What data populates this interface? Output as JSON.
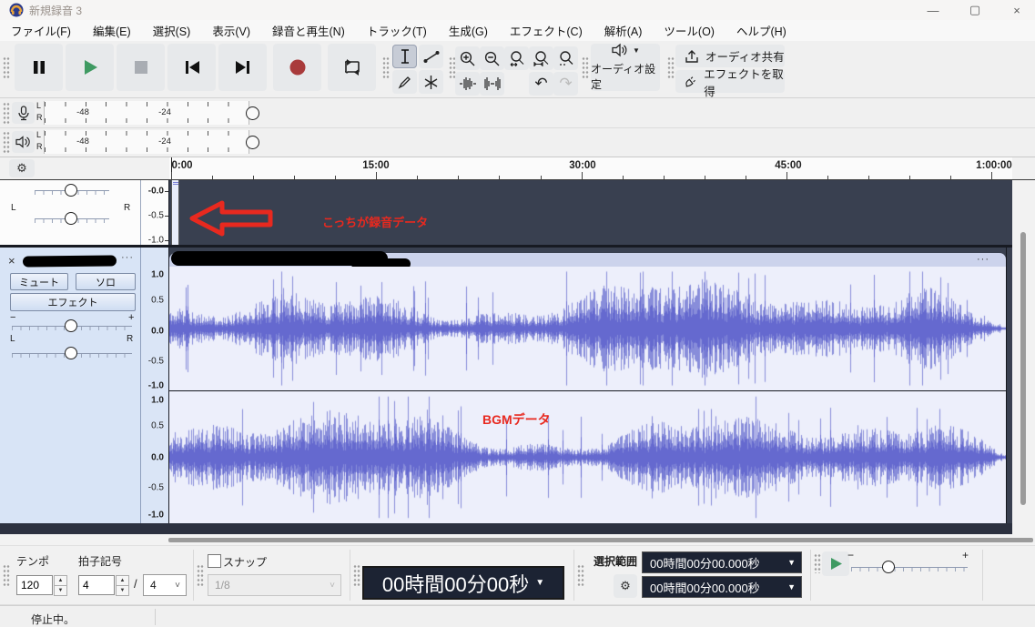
{
  "window": {
    "title": "新規録音 3",
    "minimize": "—",
    "maximize": "▢",
    "close": "×"
  },
  "menu": {
    "items": [
      "ファイル(F)",
      "編集(E)",
      "選択(S)",
      "表示(V)",
      "録音と再生(N)",
      "トラック(T)",
      "生成(G)",
      "エフェクト(C)",
      "解析(A)",
      "ツール(O)",
      "ヘルプ(H)"
    ]
  },
  "toolbar": {
    "audio_setup_label": "オーディオ設定",
    "share_audio_label": "オーディオ共有",
    "get_effects_label": "エフェクトを取得"
  },
  "meters": {
    "record": {
      "left": "L",
      "right": "R",
      "ticks": [
        "-48",
        "-24"
      ]
    },
    "playback": {
      "left": "L",
      "right": "R",
      "ticks": [
        "-48",
        "-24"
      ]
    }
  },
  "timeline": {
    "labels": [
      "0:00",
      "15:00",
      "30:00",
      "45:00",
      "1:00:00"
    ]
  },
  "track1": {
    "ruler": [
      "-0.0",
      "-0.5",
      "-1.0"
    ],
    "annotation": "こっちが録音データ"
  },
  "track2": {
    "close": "×",
    "menu_dots": "···",
    "mute_label": "ミュート",
    "solo_label": "ソロ",
    "effects_label": "エフェクト",
    "gain_minus": "−",
    "gain_plus": "+",
    "pan_left": "L",
    "pan_right": "R",
    "clip_menu_dots": "···",
    "ruler_ch1": [
      "1.0",
      "0.5",
      "0.0",
      "-0.5",
      "-1.0"
    ],
    "ruler_ch2": [
      "1.0",
      "0.5",
      "0.0",
      "-0.5",
      "-1.0"
    ],
    "annotation": "BGMデータ"
  },
  "waveform": {
    "bg": "#edeffb",
    "peak_color": "#888dda",
    "rms_color": "#6569cf",
    "seeds": [
      11,
      29
    ]
  },
  "colors": {
    "play_green": "#3f9a62",
    "record_red": "#a93b3b",
    "annotation_red": "#e8291f",
    "track_background_dark": "#394050",
    "selected_panel_blue": "#d8e4f6"
  },
  "bottom": {
    "tempo_label": "テンポ",
    "tempo_value": "120",
    "timesig_label": "拍子記号",
    "timesig_upper": "4",
    "timesig_divider": "/",
    "timesig_lower": "4",
    "snap_label": "スナップ",
    "snap_value": "1/8",
    "time_display": "00時間00分00秒",
    "selection_label": "選択範囲",
    "selection_start": "00時間00分00.000秒",
    "selection_end": "00時間00分00.000秒",
    "slider_minus": "−",
    "slider_plus": "+"
  },
  "status": {
    "text": "停止中。"
  }
}
